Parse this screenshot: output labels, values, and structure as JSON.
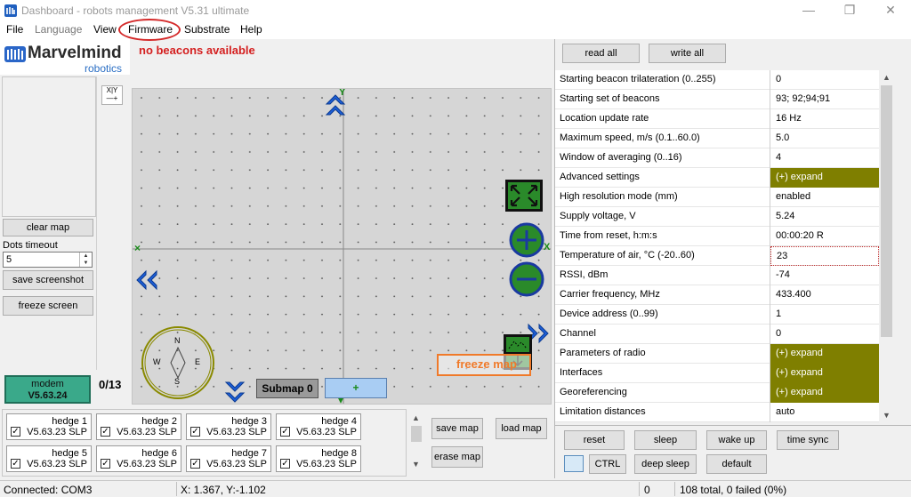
{
  "window": {
    "title": "Dashboard - robots management   V5.31   ultimate",
    "minimize": "—",
    "maximize": "❐",
    "close": "✕"
  },
  "menu": {
    "items": [
      "File",
      "Language",
      "View",
      "Firmware",
      "Substrate",
      "Help"
    ]
  },
  "logo": {
    "name": "Marvelmind",
    "sub": "robotics"
  },
  "status_message": "no beacons available",
  "left": {
    "clear_map": "clear map",
    "dots_timeout_label": "Dots timeout",
    "dots_timeout_value": "5",
    "save_screenshot": "save screenshot",
    "freeze_screen": "freeze screen",
    "modem_label": "modem",
    "modem_version": "V5.63.24",
    "count": "0/13"
  },
  "map": {
    "submap_label": "Submap 0",
    "add_submap": "+",
    "freeze_map": "freeze map",
    "compass": {
      "n": "N",
      "s": "S",
      "w": "W",
      "e": "E"
    },
    "axis_x_label": "X",
    "axis_y_label": "Y"
  },
  "hedges": [
    {
      "name": "hedge 1",
      "version": "V5.63.23 SLP",
      "checked": true
    },
    {
      "name": "hedge 2",
      "version": "V5.63.23 SLP",
      "checked": true
    },
    {
      "name": "hedge 3",
      "version": "V5.63.23 SLP",
      "checked": true
    },
    {
      "name": "hedge 4",
      "version": "V5.63.23 SLP",
      "checked": true
    },
    {
      "name": "hedge 5",
      "version": "V5.63.23 SLP",
      "checked": true
    },
    {
      "name": "hedge 6",
      "version": "V5.63.23 SLP",
      "checked": true
    },
    {
      "name": "hedge 7",
      "version": "V5.63.23 SLP",
      "checked": true
    },
    {
      "name": "hedge 8",
      "version": "V5.63.23 SLP",
      "checked": true
    }
  ],
  "map_buttons": {
    "save_map": "save map",
    "load_map": "load map",
    "erase_map": "erase map"
  },
  "right": {
    "read_all": "read all",
    "write_all": "write all",
    "properties": [
      {
        "name": "Starting beacon trilateration (0..255)",
        "value": "0",
        "kind": "plain"
      },
      {
        "name": "Starting set of beacons",
        "value": "93;  92;94;91",
        "kind": "plain"
      },
      {
        "name": "Location update rate",
        "value": "16 Hz",
        "kind": "plain"
      },
      {
        "name": "Maximum speed, m/s (0.1..60.0)",
        "value": "5.0",
        "kind": "plain"
      },
      {
        "name": "Window of averaging (0..16)",
        "value": "4",
        "kind": "plain"
      },
      {
        "name": "Advanced settings",
        "value": "(+) expand",
        "kind": "expand"
      },
      {
        "name": "High resolution mode (mm)",
        "value": "enabled",
        "kind": "plain"
      },
      {
        "name": "Supply voltage, V",
        "value": "5.24",
        "kind": "plain"
      },
      {
        "name": "Time from reset, h:m:s",
        "value": "00:00:20   R",
        "kind": "plain"
      },
      {
        "name": "Temperature of air, °C (-20..60)",
        "value": "23",
        "kind": "selected"
      },
      {
        "name": "RSSI, dBm",
        "value": "-74",
        "kind": "plain"
      },
      {
        "name": "Carrier frequency, MHz",
        "value": "433.400",
        "kind": "plain"
      },
      {
        "name": "Device address (0..99)",
        "value": "1",
        "kind": "plain"
      },
      {
        "name": "Channel",
        "value": "0",
        "kind": "plain"
      },
      {
        "name": "Parameters of radio",
        "value": "(+) expand",
        "kind": "expand"
      },
      {
        "name": "Interfaces",
        "value": "(+) expand",
        "kind": "expand"
      },
      {
        "name": "Georeferencing",
        "value": "(+) expand",
        "kind": "expand"
      },
      {
        "name": "Limitation distances",
        "value": "auto",
        "kind": "plain"
      }
    ],
    "reset": "reset",
    "sleep": "sleep",
    "wake_up": "wake up",
    "time_sync": "time sync",
    "ctrl": "CTRL",
    "deep_sleep": "deep sleep",
    "default": "default"
  },
  "statusbar": {
    "connection": "Connected: COM3",
    "coords": "X: 1.367, Y:-1.102",
    "zero": "0",
    "total": "108 total, 0 failed (0%)"
  },
  "colors": {
    "expand_bg": "#7f7f00",
    "modem_bg": "#3aa98a",
    "nav_blue": "#1d5fd8",
    "zoom_green": "#2a8a2a",
    "alert_red": "#d42020",
    "freeze_orange": "#f07a2a"
  }
}
